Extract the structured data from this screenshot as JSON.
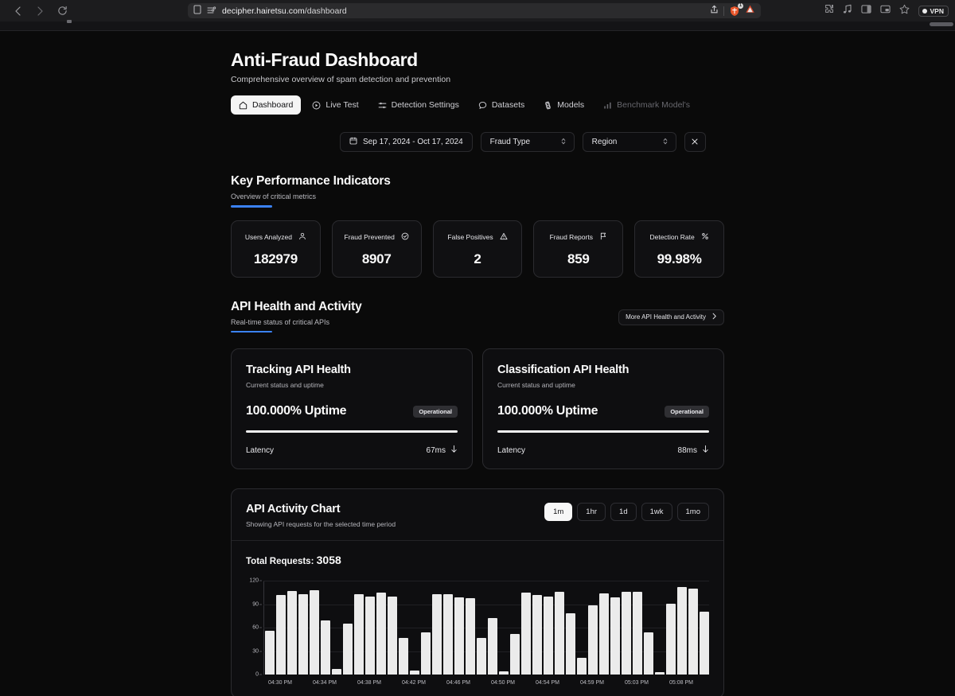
{
  "browser": {
    "url_prefix": "decipher.hairetsu.com",
    "url_path": "/dashboard",
    "back_icon": "back-chevron-icon",
    "forward_icon": "forward-chevron-icon",
    "reload_icon": "reload-icon",
    "reader_icon": "reader-mode-icon",
    "shield_icon": "shield-icon",
    "extension_badge": "1",
    "share_icon": "share-icon",
    "warning_icon": "warning-triangle-icon",
    "vpn_label": "VPN"
  },
  "header": {
    "title": "Anti-Fraud Dashboard",
    "subtitle": "Comprehensive overview of spam detection and prevention"
  },
  "nav": {
    "tabs": [
      {
        "label": "Dashboard",
        "icon": "home-icon",
        "active": true,
        "muted": false
      },
      {
        "label": "Live Test",
        "icon": "play-circle-icon",
        "active": false,
        "muted": false
      },
      {
        "label": "Detection Settings",
        "icon": "sliders-icon",
        "active": false,
        "muted": false
      },
      {
        "label": "Datasets",
        "icon": "chat-bubble-icon",
        "active": false,
        "muted": false
      },
      {
        "label": "Models",
        "icon": "atom-icon",
        "active": false,
        "muted": false
      },
      {
        "label": "Benchmark Model's",
        "icon": "bar-chart-icon",
        "active": false,
        "muted": true
      }
    ]
  },
  "filters": {
    "date_range": "Sep 17, 2024 - Oct 17, 2024",
    "date_icon": "calendar-icon",
    "fraud_type": "Fraud Type",
    "region": "Region",
    "clear_icon": "close-x-icon"
  },
  "kpi_section": {
    "title": "Key Performance Indicators",
    "subtitle": "Overview of critical metrics",
    "accent_color": "#3b82f6",
    "cards": [
      {
        "label": "Users Analyzed",
        "value": "182979",
        "icon": "user-icon"
      },
      {
        "label": "Fraud Prevented",
        "value": "8907",
        "icon": "shield-check-icon"
      },
      {
        "label": "False Positives",
        "value": "2",
        "icon": "alert-triangle-icon"
      },
      {
        "label": "Fraud Reports",
        "value": "859",
        "icon": "flag-icon"
      },
      {
        "label": "Detection Rate",
        "value": "99.98%",
        "icon": "percent-icon"
      }
    ]
  },
  "api_section": {
    "title": "API Health and Activity",
    "subtitle": "Real-time status of critical APIs",
    "action_label": "More API Health and Activity",
    "action_icon": "chevron-right-icon",
    "cards": [
      {
        "title": "Tracking API Health",
        "subtitle": "Current status and uptime",
        "uptime": "100.000% Uptime",
        "status": "Operational",
        "progress": 100,
        "latency_label": "Latency",
        "latency_value": "67ms",
        "latency_icon": "arrow-down-icon"
      },
      {
        "title": "Classification API Health",
        "subtitle": "Current status and uptime",
        "uptime": "100.000% Uptime",
        "status": "Operational",
        "progress": 100,
        "latency_label": "Latency",
        "latency_value": "88ms",
        "latency_icon": "arrow-down-icon"
      }
    ]
  },
  "chart_card": {
    "title": "API Activity Chart",
    "subtitle": "Showing API requests for the selected time period",
    "ranges": [
      {
        "label": "1m",
        "active": true
      },
      {
        "label": "1hr",
        "active": false
      },
      {
        "label": "1d",
        "active": false
      },
      {
        "label": "1wk",
        "active": false
      },
      {
        "label": "1mo",
        "active": false
      }
    ],
    "total_label": "Total Requests:",
    "total_value": "3058"
  },
  "chart_data": {
    "type": "bar",
    "title": "API Activity Chart",
    "subtitle": "Showing API requests for the selected time period",
    "xlabel": "",
    "ylabel": "",
    "ylim": [
      0,
      120
    ],
    "yticks": [
      0,
      30,
      60,
      90,
      120
    ],
    "grid": true,
    "legend": "none",
    "bar_color": "#ebebeb",
    "tick_labels": [
      "04:30 PM",
      "04:34 PM",
      "04:38 PM",
      "04:42 PM",
      "04:46 PM",
      "04:50 PM",
      "04:54 PM",
      "04:59 PM",
      "05:03 PM",
      "05:08 PM"
    ],
    "tick_indices": [
      1,
      5,
      9,
      13,
      17,
      21,
      25,
      29,
      33,
      37
    ],
    "values": [
      56,
      102,
      107,
      103,
      108,
      69,
      7,
      65,
      103,
      100,
      105,
      100,
      47,
      5,
      54,
      103,
      103,
      99,
      98,
      47,
      72,
      4,
      52,
      105,
      102,
      100,
      106,
      78,
      21,
      88,
      104,
      99,
      106,
      106,
      54,
      3,
      91,
      112,
      110,
      80
    ],
    "count": 40
  }
}
